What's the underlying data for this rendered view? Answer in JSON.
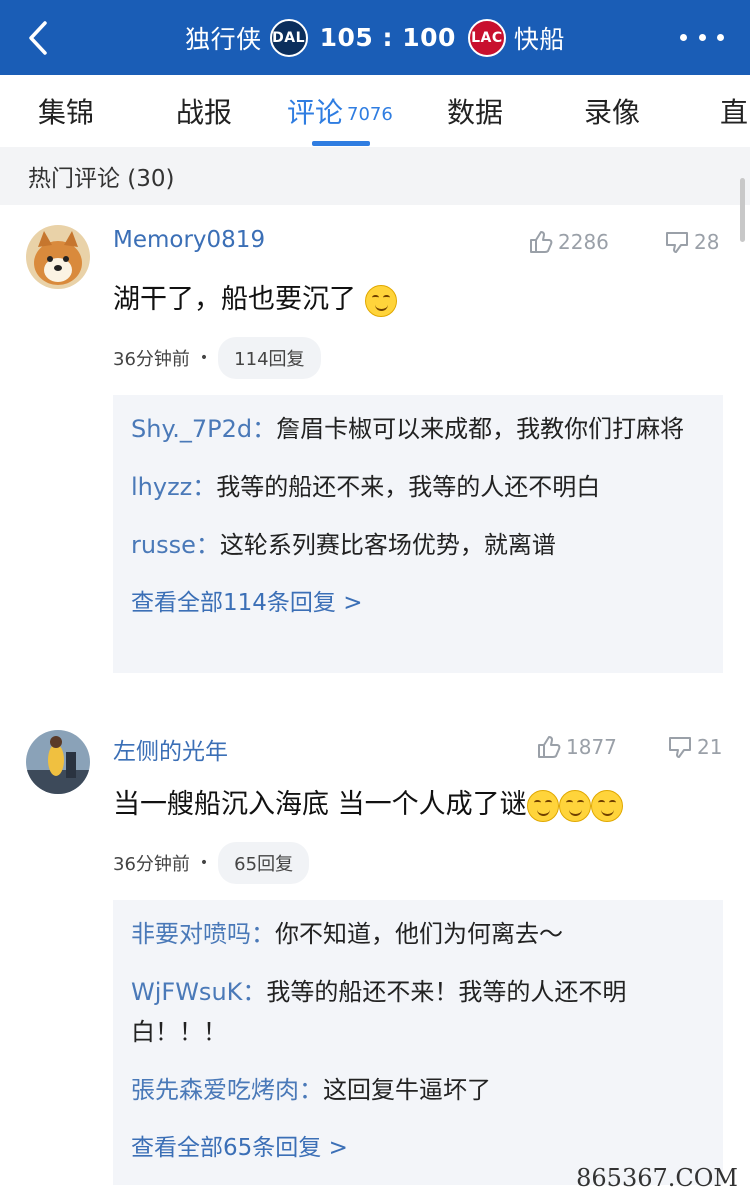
{
  "header": {
    "home_team": "独行侠",
    "home_logo": "DAL",
    "score": "105 : 100",
    "away_logo": "LAC",
    "away_team": "快船"
  },
  "tabs": [
    {
      "label": "集锦"
    },
    {
      "label": "战报"
    },
    {
      "label": "评论",
      "count": "7076"
    },
    {
      "label": "数据"
    },
    {
      "label": "录像"
    },
    {
      "label": "直"
    }
  ],
  "section": {
    "title": "热门评论 (30)"
  },
  "comments": [
    {
      "author": "Memory0819",
      "likes": "2286",
      "dislikes": "28",
      "text": "湖干了，船也要沉了",
      "time": "36分钟前",
      "reply_count": "114回复",
      "replies": [
        {
          "who": "Shy._7P2d：",
          "text": "詹眉卡椒可以来成都，我教你们打麻将"
        },
        {
          "who": "lhyzz：",
          "text": "我等的船还不来，我等的人还不明白"
        },
        {
          "who": "russe：",
          "text": "这轮系列赛比客场优势，就离谱"
        }
      ],
      "view_all": "查看全部114条回复 >"
    },
    {
      "author": "左侧的光年",
      "likes": "1877",
      "dislikes": "21",
      "text": "当一艘船沉入海底 当一个人成了谜",
      "time": "36分钟前",
      "reply_count": "65回复",
      "replies": [
        {
          "who": "非要对喷吗：",
          "text": "你不知道，他们为何离去～"
        },
        {
          "who": "WjFWsuK：",
          "text": "我等的船还不来！我等的人还不明白！！！"
        },
        {
          "who": "張先森爱吃烤肉：",
          "text": "这回复牛逼坏了"
        }
      ],
      "view_all": "查看全部65条回复 >"
    }
  ],
  "watermark": "865367.COM",
  "colors": {
    "header_bg": "#1a5db6",
    "accent": "#2f7de1",
    "link": "#3b6fb6"
  }
}
